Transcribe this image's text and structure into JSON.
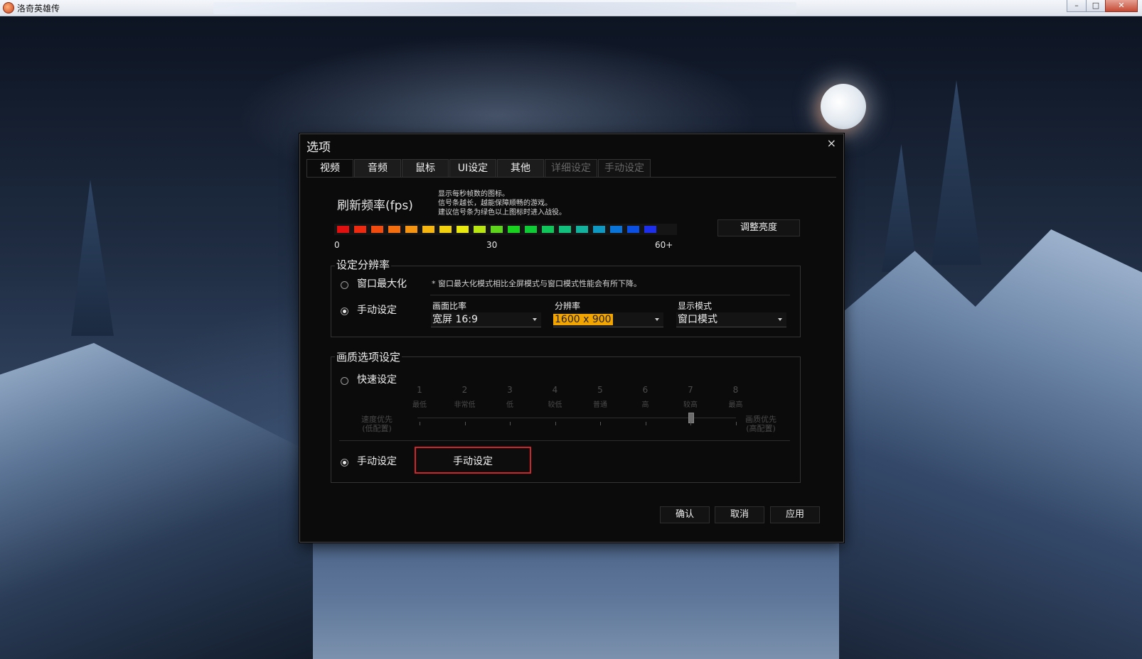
{
  "window": {
    "title": "洛奇英雄传",
    "controls": {
      "minimize": "–",
      "maximize": "□",
      "close": "✕"
    }
  },
  "dialog": {
    "title": "选项",
    "close": "×",
    "tabs": [
      {
        "label": "视频",
        "state": "active"
      },
      {
        "label": "音频",
        "state": "normal"
      },
      {
        "label": "鼠标",
        "state": "normal"
      },
      {
        "label": "UI设定",
        "state": "normal"
      },
      {
        "label": "其他",
        "state": "normal"
      },
      {
        "label": "详细设定",
        "state": "disabled"
      },
      {
        "label": "手动设定",
        "state": "disabled"
      }
    ],
    "fps": {
      "title": "刷新频率(fps)",
      "desc_lines": [
        "显示每秒帧数的图标。",
        "信号条越长，越能保障顺畅的游戏。",
        "建议信号条为绿色以上图标时进入战役。"
      ],
      "bar_colors": [
        "#e01010",
        "#ee2a10",
        "#f24b0f",
        "#f46d0f",
        "#f59412",
        "#f5b611",
        "#f1d10f",
        "#e9e80f",
        "#b9e612",
        "#5fd41c",
        "#19d21f",
        "#0fcc36",
        "#10c65a",
        "#12bf7d",
        "#13b29e",
        "#0e98c2",
        "#0b74d8",
        "#0b4fe2",
        "#1d2fea"
      ],
      "labels": {
        "min": "0",
        "mid": "30",
        "max": "60+"
      },
      "brightness_button": "调整亮度"
    },
    "resolution": {
      "group_title": "设定分辨率",
      "maximize_option": "窗口最大化",
      "maximize_note": "* 窗口最大化模式相比全屏模式与窗口模式性能会有所下降。",
      "manual_option": "手动设定",
      "aspect": {
        "label": "画面比率",
        "value": "宽屏 16:9"
      },
      "resolution": {
        "label": "分辨率",
        "value": "1600 x 900"
      },
      "display_mode": {
        "label": "显示模式",
        "value": "窗口模式"
      }
    },
    "quality": {
      "group_title": "画质选项设定",
      "quick_option": "快速设定",
      "levels": [
        {
          "num": "1",
          "name": "最低"
        },
        {
          "num": "2",
          "name": "非常低"
        },
        {
          "num": "3",
          "name": "低"
        },
        {
          "num": "4",
          "name": "较低"
        },
        {
          "num": "5",
          "name": "普通"
        },
        {
          "num": "6",
          "name": "高"
        },
        {
          "num": "7",
          "name": "较高"
        },
        {
          "num": "8",
          "name": "最高"
        }
      ],
      "left_side": [
        "速度优先",
        "(低配置)"
      ],
      "right_side": [
        "画质优先",
        "(高配置)"
      ],
      "slider_level": 7,
      "manual_option": "手动设定",
      "manual_button": "手动设定"
    },
    "footer": {
      "confirm": "确认",
      "cancel": "取消",
      "apply": "应用"
    }
  }
}
